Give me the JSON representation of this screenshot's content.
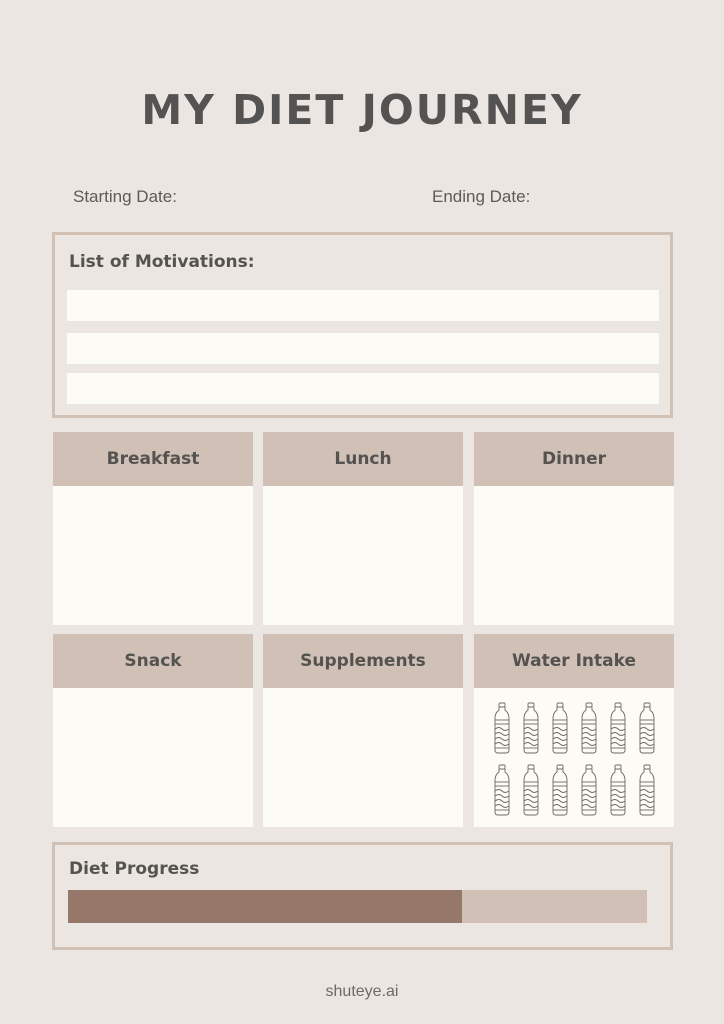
{
  "title": "MY DIET JOURNEY",
  "dates": {
    "start_label": "Starting Date:",
    "end_label": "Ending Date:"
  },
  "motivations": {
    "label": "List of Motivations:",
    "lines": [
      "",
      "",
      ""
    ]
  },
  "meals": {
    "breakfast": "Breakfast",
    "lunch": "Lunch",
    "dinner": "Dinner",
    "snack": "Snack",
    "supplements": "Supplements",
    "water": "Water Intake"
  },
  "water_bottles": {
    "count": 12,
    "icon": "water-bottle-icon"
  },
  "progress": {
    "label": "Diet Progress",
    "percent": 68,
    "fill_color": "#957869",
    "track_color": "#d0c0b5"
  },
  "footer": "shuteye.ai"
}
